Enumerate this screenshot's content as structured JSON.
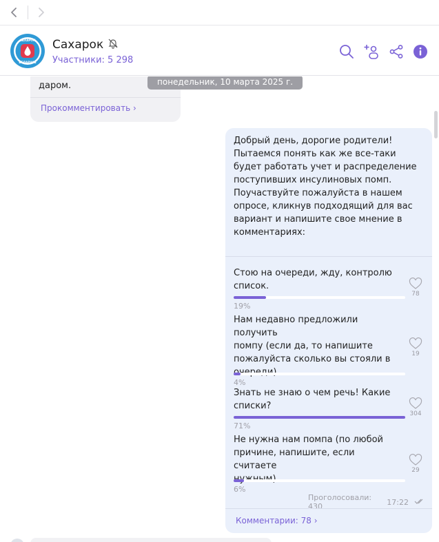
{
  "header": {
    "title": "Сахарок",
    "subtitle": "Участники: 5 298",
    "avatar_text_top": "САХАРОК",
    "avatar_text_bottom": "БЕЛАРУСЬ"
  },
  "previous_message": {
    "text_tail": "даром.",
    "comment_link": "Прокомментировать ›"
  },
  "date_separator": "понедельник, 10 марта 2025 г.",
  "post": {
    "text": "Добрый день, дорогие родители!\nПытаемся понять как же все-таки\nбудет работать учет и распределение\nпоступивших инсулиновых помп.\nПоучаствуйте пожалуйста в нашем\nопросе, кликнув подходящий для вас\nвариант и напишите свое мнение в\nкомментариях:",
    "poll": {
      "options": [
        {
          "text": "Стою на очереди, жду, контролю\nсписок.",
          "percent_label": "19%",
          "fraction": 0.19,
          "count": "78"
        },
        {
          "text": "Нам недавно предложили получить\nпомпу (если да, то напишите\nпожалуйста сколько вы стояли в\nочереди)",
          "percent_label": "4%",
          "fraction": 0.04,
          "count": "19"
        },
        {
          "text": "Знать не знаю о чем речь! Какие\nсписки?",
          "percent_label": "71%",
          "fraction": 1.0,
          "count": "304"
        },
        {
          "text": "Не нужна нам помпа (по любой\nпричине, напишите, если считаете\nнужным)",
          "percent_label": "6%",
          "fraction": 0.06,
          "count": "29"
        }
      ]
    },
    "voted": "Проголосовали: 430",
    "time": "17:22",
    "comments_link": "Комментарии: 78 ›"
  },
  "colors": {
    "accent": "#7a62d6",
    "avatar_blue": "#2f9ad6",
    "avatar_red": "#e23a4e",
    "bubble": "#eaf0fb"
  },
  "icons": [
    "back-arrow-icon",
    "forward-arrow-icon",
    "muted-bell-icon",
    "search-icon",
    "add-user-icon",
    "share-icon",
    "info-icon",
    "heart-icon",
    "double-check-icon"
  ]
}
